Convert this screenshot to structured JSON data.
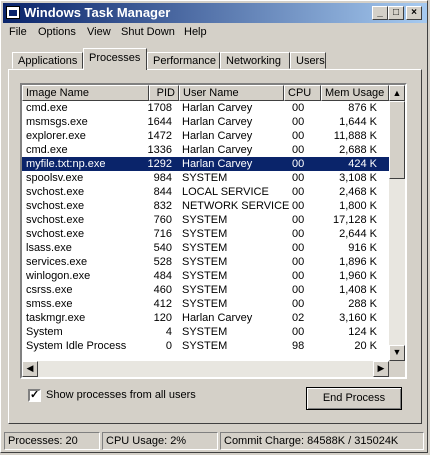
{
  "window": {
    "title": "Windows Task Manager"
  },
  "title_buttons": {
    "minimize": "_",
    "maximize": "□",
    "close": "×"
  },
  "menu": [
    "File",
    "Options",
    "View",
    "Shut Down",
    "Help"
  ],
  "tabs": [
    "Applications",
    "Processes",
    "Performance",
    "Networking",
    "Users"
  ],
  "active_tab": "Processes",
  "columns": [
    "Image Name",
    "PID",
    "User Name",
    "CPU",
    "Mem Usage"
  ],
  "processes": [
    {
      "name": "cmd.exe",
      "pid": "1708",
      "user": "Harlan Carvey",
      "cpu": "00",
      "mem": "876 K"
    },
    {
      "name": "msmsgs.exe",
      "pid": "1644",
      "user": "Harlan Carvey",
      "cpu": "00",
      "mem": "1,644 K"
    },
    {
      "name": "explorer.exe",
      "pid": "1472",
      "user": "Harlan Carvey",
      "cpu": "00",
      "mem": "11,888 K"
    },
    {
      "name": "cmd.exe",
      "pid": "1336",
      "user": "Harlan Carvey",
      "cpu": "00",
      "mem": "2,688 K"
    },
    {
      "name": "myfile.txt:np.exe",
      "pid": "1292",
      "user": "Harlan Carvey",
      "cpu": "00",
      "mem": "424 K",
      "selected": true
    },
    {
      "name": "spoolsv.exe",
      "pid": "984",
      "user": "SYSTEM",
      "cpu": "00",
      "mem": "3,108 K"
    },
    {
      "name": "svchost.exe",
      "pid": "844",
      "user": "LOCAL SERVICE",
      "cpu": "00",
      "mem": "2,468 K"
    },
    {
      "name": "svchost.exe",
      "pid": "832",
      "user": "NETWORK SERVICE",
      "cpu": "00",
      "mem": "1,800 K"
    },
    {
      "name": "svchost.exe",
      "pid": "760",
      "user": "SYSTEM",
      "cpu": "00",
      "mem": "17,128 K"
    },
    {
      "name": "svchost.exe",
      "pid": "716",
      "user": "SYSTEM",
      "cpu": "00",
      "mem": "2,644 K"
    },
    {
      "name": "lsass.exe",
      "pid": "540",
      "user": "SYSTEM",
      "cpu": "00",
      "mem": "916 K"
    },
    {
      "name": "services.exe",
      "pid": "528",
      "user": "SYSTEM",
      "cpu": "00",
      "mem": "1,896 K"
    },
    {
      "name": "winlogon.exe",
      "pid": "484",
      "user": "SYSTEM",
      "cpu": "00",
      "mem": "1,960 K"
    },
    {
      "name": "csrss.exe",
      "pid": "460",
      "user": "SYSTEM",
      "cpu": "00",
      "mem": "1,408 K"
    },
    {
      "name": "smss.exe",
      "pid": "412",
      "user": "SYSTEM",
      "cpu": "00",
      "mem": "288 K"
    },
    {
      "name": "taskmgr.exe",
      "pid": "120",
      "user": "Harlan Carvey",
      "cpu": "02",
      "mem": "3,160 K"
    },
    {
      "name": "System",
      "pid": "4",
      "user": "SYSTEM",
      "cpu": "00",
      "mem": "124 K"
    },
    {
      "name": "System Idle Process",
      "pid": "0",
      "user": "SYSTEM",
      "cpu": "98",
      "mem": "20 K"
    }
  ],
  "show_all_users": {
    "label": "Show processes from all users",
    "checked": true,
    "mark": "✓"
  },
  "end_process_label": "End Process",
  "status": {
    "processes": "Processes: 20",
    "cpu": "CPU Usage: 2%",
    "commit": "Commit Charge: 84588K / 315024K"
  },
  "icons": {
    "scroll_up": "up-arrow-icon",
    "scroll_down": "down-arrow-icon",
    "scroll_left": "left-arrow-icon",
    "scroll_right": "right-arrow-icon",
    "app": "task-manager-icon"
  },
  "colors": {
    "titlebar_start": "#0a246a",
    "titlebar_end": "#a6caf0",
    "selection": "#0a246a",
    "face": "#d4d0c8"
  }
}
